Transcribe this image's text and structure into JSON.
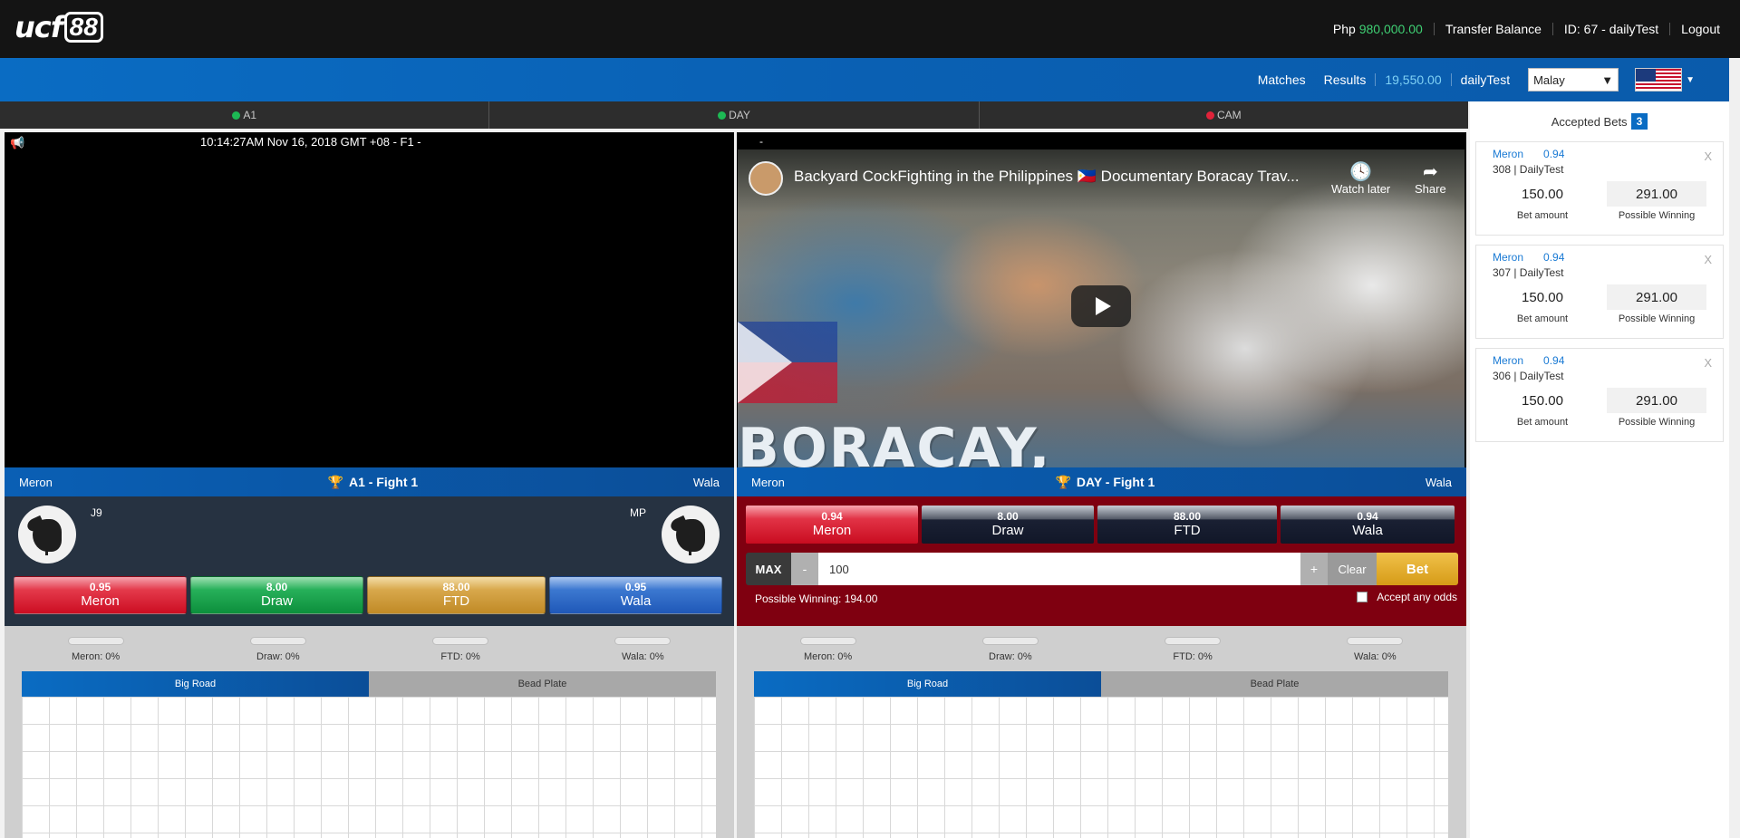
{
  "header": {
    "logo_text": "ucf",
    "logo_box": "88",
    "currency": "Php",
    "balance": "980,000.00",
    "transfer_label": "Transfer Balance",
    "user_id": "ID: 67 - dailyTest",
    "logout_label": "Logout"
  },
  "nav": {
    "matches_label": "Matches",
    "results_label": "Results",
    "credit": "19,550.00",
    "username": "dailyTest",
    "language": "Malay",
    "flag_icon": "us-flag-icon"
  },
  "tabs": [
    {
      "label": "A1",
      "status": "green"
    },
    {
      "label": "DAY",
      "status": "green"
    },
    {
      "label": "CAM",
      "status": "red"
    }
  ],
  "left_panel": {
    "timestamp": "10:14:27AM Nov 16, 2018 GMT +08 - F1 -",
    "meron_label": "Meron",
    "wala_label": "Wala",
    "title": "A1 - Fight 1",
    "meron_code": "J9",
    "wala_code": "MP",
    "odds": [
      {
        "odds": "0.95",
        "label": "Meron"
      },
      {
        "odds": "8.00",
        "label": "Draw"
      },
      {
        "odds": "88.00",
        "label": "FTD"
      },
      {
        "odds": "0.95",
        "label": "Wala"
      }
    ],
    "stats": {
      "meron": "Meron: 0%",
      "draw": "Draw: 0%",
      "ftd": "FTD: 0%",
      "wala": "Wala: 0%"
    },
    "road_tabs": [
      "Big Road",
      "Bead Plate"
    ]
  },
  "right_panel": {
    "dash": "-",
    "video_title": "Backyard CockFighting in the Philippines 🇵🇭 Documentary Boracay Trav...",
    "watch_later": "Watch later",
    "share": "Share",
    "video_overlay_text": "BORACAY,",
    "meron_label": "Meron",
    "wala_label": "Wala",
    "title": "DAY - Fight 1",
    "odds": [
      {
        "odds": "0.94",
        "label": "Meron"
      },
      {
        "odds": "8.00",
        "label": "Draw"
      },
      {
        "odds": "88.00",
        "label": "FTD"
      },
      {
        "odds": "0.94",
        "label": "Wala"
      }
    ],
    "bet": {
      "max_label": "MAX",
      "minus_label": "-",
      "amount": "100",
      "plus_label": "+",
      "clear_label": "Clear",
      "bet_label": "Bet",
      "possible_winning": "Possible Winning: 194.00",
      "accept_any_odds": "Accept any odds"
    },
    "stats": {
      "meron": "Meron: 0%",
      "draw": "Draw: 0%",
      "ftd": "FTD: 0%",
      "wala": "Wala: 0%"
    },
    "road_tabs": [
      "Big Road",
      "Bead Plate"
    ]
  },
  "sidebar": {
    "title": "Accepted Bets",
    "count": "3",
    "bets": [
      {
        "side": "Meron",
        "odds": "0.94",
        "ref": "308 | DailyTest",
        "amount": "150.00",
        "winning": "291.00",
        "amount_label": "Bet amount",
        "winning_label": "Possible Winning",
        "close": "X"
      },
      {
        "side": "Meron",
        "odds": "0.94",
        "ref": "307 | DailyTest",
        "amount": "150.00",
        "winning": "291.00",
        "amount_label": "Bet amount",
        "winning_label": "Possible Winning",
        "close": "X"
      },
      {
        "side": "Meron",
        "odds": "0.94",
        "ref": "306 | DailyTest",
        "amount": "150.00",
        "winning": "291.00",
        "amount_label": "Bet amount",
        "winning_label": "Possible Winning",
        "close": "X"
      }
    ]
  },
  "colors": {
    "accent_blue": "#0a6cc3",
    "balance_green": "#3fcf73",
    "bet_panel_red": "#7f0010",
    "bet_gold": "#d69b17"
  }
}
